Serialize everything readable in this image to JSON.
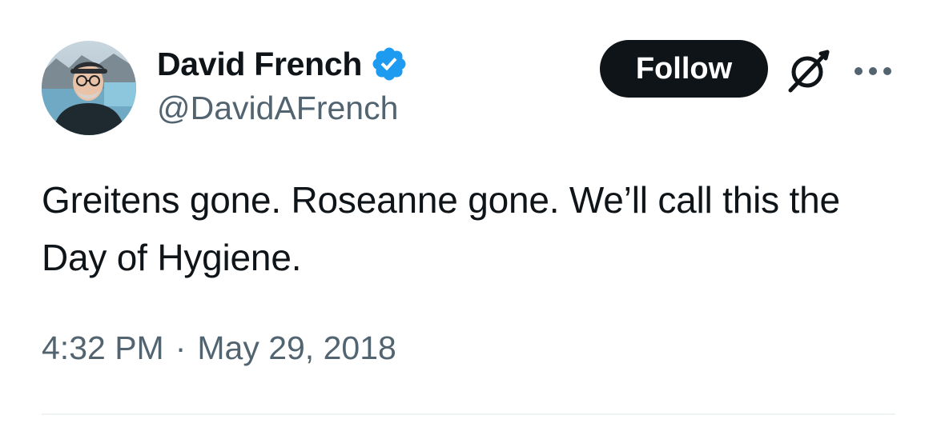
{
  "author": {
    "display_name": "David French",
    "handle": "@DavidAFrench",
    "verified": true,
    "verified_color": "#1d9bf0"
  },
  "actions": {
    "follow_label": "Follow",
    "grok_icon": "grok-icon",
    "more_icon": "more-icon"
  },
  "tweet": {
    "text": "Greitens gone. Roseanne gone. We’ll call this the Day of Hygiene.",
    "time": "4:32 PM",
    "separator": "·",
    "date": "May 29, 2018"
  },
  "colors": {
    "text_primary": "#0f1419",
    "text_secondary": "#536471",
    "follow_bg": "#0f1419",
    "divider": "#eff3f4"
  }
}
